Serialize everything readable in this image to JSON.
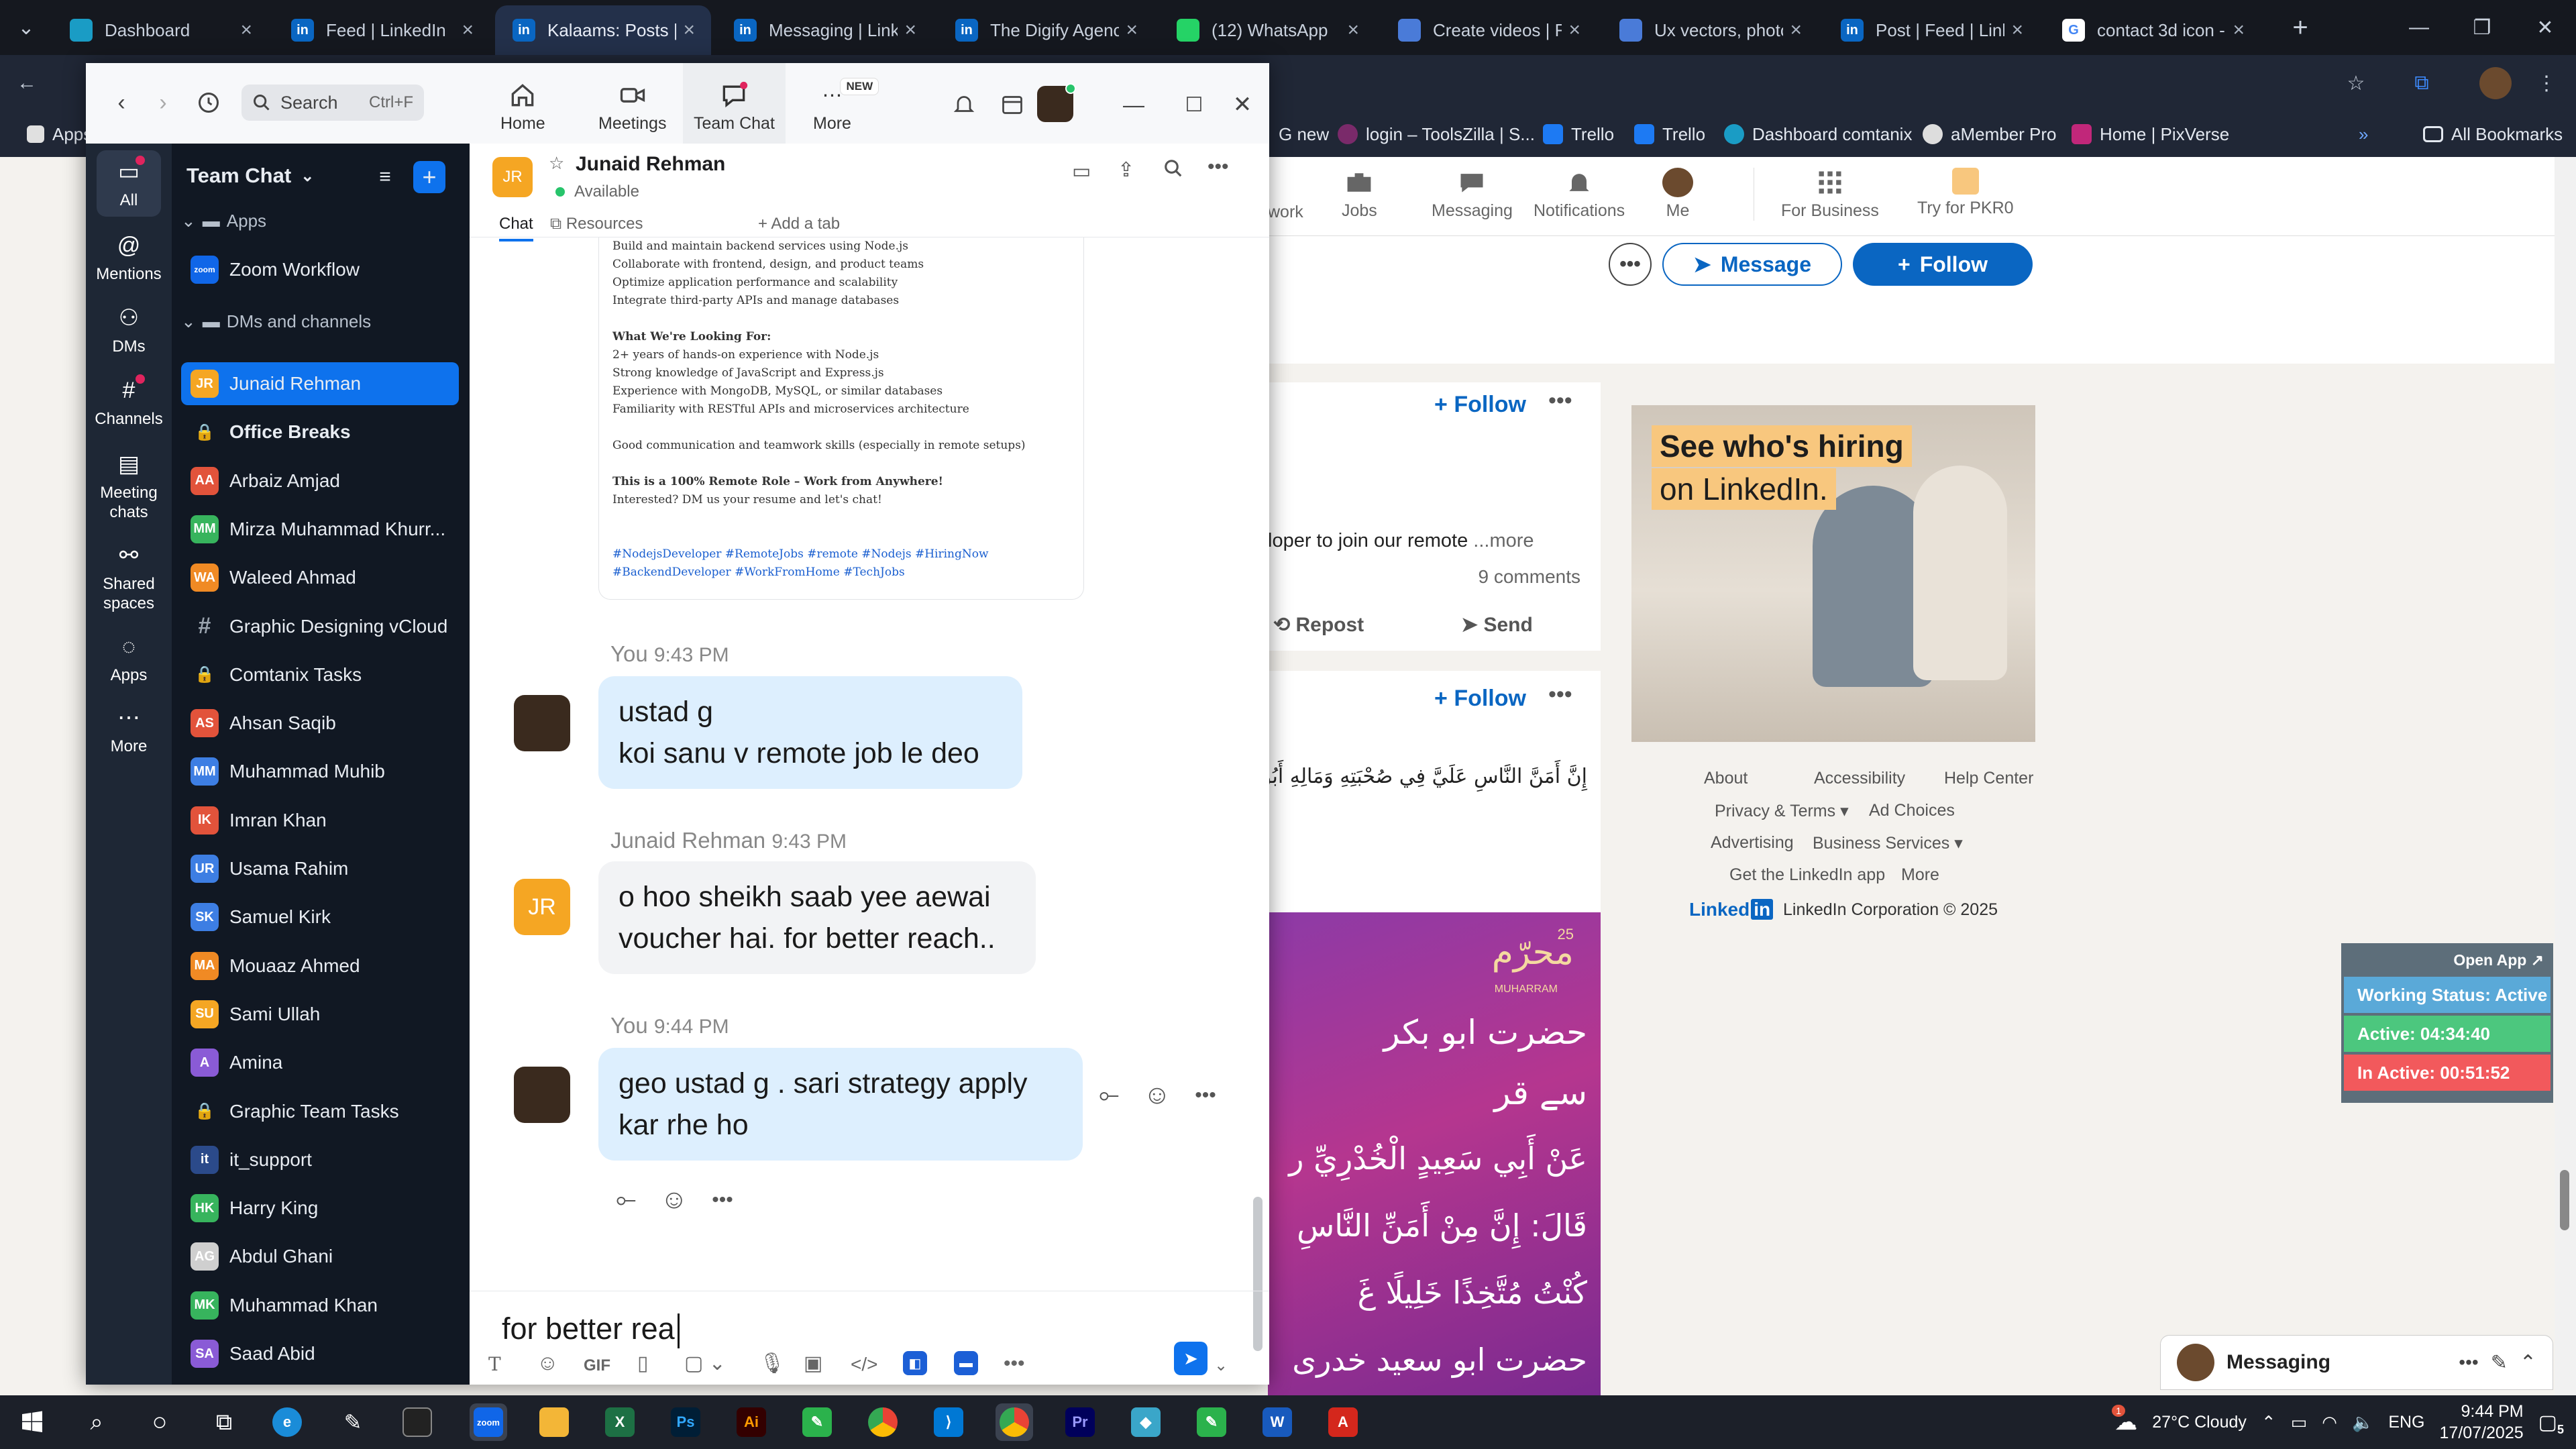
{
  "browser": {
    "tabs": [
      {
        "title": "Dashboard",
        "icon": "dashboard-favicon-icon",
        "color": "#1a9cc5"
      },
      {
        "title": "Feed | LinkedIn",
        "icon": "linkedin-favicon-icon",
        "color": "#0a66c2"
      },
      {
        "title": "Kalaams: Posts | L",
        "icon": "linkedin-favicon-icon",
        "color": "#0a66c2",
        "active": true
      },
      {
        "title": "Messaging | Linke",
        "icon": "linkedin-favicon-icon",
        "color": "#0a66c2"
      },
      {
        "title": "The Digify Agency",
        "icon": "linkedin-favicon-icon",
        "color": "#0a66c2"
      },
      {
        "title": "(12) WhatsApp",
        "icon": "whatsapp-favicon-icon",
        "color": "#25d366"
      },
      {
        "title": "Create videos | Fr",
        "icon": "docs-favicon-icon",
        "color": "#4a7bd8"
      },
      {
        "title": "Ux vectors, photo",
        "icon": "docs-favicon-icon",
        "color": "#4a7bd8"
      },
      {
        "title": "Post | Feed | Linke",
        "icon": "linkedin-favicon-icon",
        "color": "#0a66c2"
      },
      {
        "title": "contact 3d icon -",
        "icon": "google-favicon-icon",
        "color": "#ffffff"
      }
    ],
    "bookmarks": [
      {
        "label": "Apps",
        "color": "#e0e0e0"
      },
      {
        "label": "G new",
        "color": "#4285f4"
      },
      {
        "label": "login – ToolsZilla | S...",
        "color": "#7a2a6a"
      },
      {
        "label": "Trello",
        "color": "#1d7af3"
      },
      {
        "label": "Trello",
        "color": "#1d7af3"
      },
      {
        "label": "Dashboard comtanix",
        "color": "#1a9cc5"
      },
      {
        "label": "aMember Pro",
        "color": "#dddddd"
      },
      {
        "label": "Home | PixVerse",
        "color": "#c1277a"
      }
    ],
    "all_bookmarks": "All Bookmarks"
  },
  "linkedin": {
    "nav": [
      {
        "label": "work",
        "icon": "work-icon"
      },
      {
        "label": "Jobs",
        "icon": "briefcase-icon"
      },
      {
        "label": "Messaging",
        "icon": "messaging-icon"
      },
      {
        "label": "Notifications",
        "icon": "bell-icon"
      },
      {
        "label": "Me",
        "icon": "avatar-icon"
      },
      {
        "label": "For Business",
        "icon": "grid-icon"
      },
      {
        "label": "Try for PKR0",
        "icon": "premium-icon"
      }
    ],
    "message_button": "Message",
    "follow_button": "Follow",
    "card1": {
      "follow": "Follow",
      "snippet": "loper to join our remote",
      "more": "...more",
      "comments": "9 comments",
      "repost": "Repost",
      "send": "Send"
    },
    "card2": {
      "follow": "Follow",
      "arabic": "إِنَّ أَمَنَّ النَّاسِ عَلَيَّ فِي صُحْبَتِهِ وَمَالِهِ أَبُو بَ"
    },
    "post_image_text": [
      "محرّم",
      "MUHARRAM",
      "25",
      "حضرت ابو بکر",
      "سے قر",
      "عَنْ أَبِي سَعِيدٍ الْخُدْرِيِّ ر",
      "قَالَ: إِنَّ مِنْ أَمَنِّ النَّاسِ",
      "كُنْتُ مُتَّخِذًا خَلِيلًا غَ",
      "حضرت ابو سعید خدری"
    ],
    "ad": {
      "line1": "See who's hiring",
      "line2": "on LinkedIn."
    },
    "footer": {
      "links": [
        "About",
        "Accessibility",
        "Help Center",
        "Privacy & Terms",
        "Ad Choices",
        "Advertising",
        "Business Services",
        "Get the LinkedIn app",
        "More"
      ],
      "brand": "Linked",
      "brand_in": "in",
      "copyright": "LinkedIn Corporation © 2025"
    },
    "messaging_label": "Messaging"
  },
  "status_widget": {
    "open_app": "Open App ↗",
    "working": "Working Status: Active",
    "active": "Active: 04:34:40",
    "inactive": "In Active: 00:51:52",
    "colors": {
      "working": "#5aa9d8",
      "active": "#4cc77e",
      "inactive": "#f2595c"
    }
  },
  "zoom": {
    "search": {
      "label": "Search",
      "shortcut": "Ctrl+F"
    },
    "top_tabs": [
      {
        "label": "Home",
        "icon": "home-icon"
      },
      {
        "label": "Meetings",
        "icon": "video-camera-icon"
      },
      {
        "label": "Team Chat",
        "icon": "chat-bubble-icon",
        "active": true
      },
      {
        "label": "More",
        "icon": "more-dots-icon",
        "badge": "NEW"
      }
    ],
    "rail": [
      {
        "label": "All",
        "icon": "chat-bubble-icon",
        "selected": true
      },
      {
        "label": "Mentions",
        "icon": "at-icon"
      },
      {
        "label": "DMs",
        "icon": "people-icon"
      },
      {
        "label": "Channels",
        "icon": "hash-icon"
      },
      {
        "label": "Meeting chats",
        "icon": "calendar-icon"
      },
      {
        "label": "Shared spaces",
        "icon": "shared-icon"
      },
      {
        "label": "Apps",
        "icon": "apps-icon"
      },
      {
        "label": "More",
        "icon": "more-dots-icon"
      }
    ],
    "sidebar": {
      "title": "Team Chat",
      "apps_section": "Apps",
      "zoom_workflow": "Zoom Workflow",
      "dms_section": "DMs and channels",
      "items": [
        {
          "name": "Junaid Rehman",
          "initials": "JR",
          "color": "#f5a623",
          "selected": true
        },
        {
          "name": "Office Breaks",
          "initials": "",
          "color": "#3a4352",
          "lock": true,
          "bold": true
        },
        {
          "name": "Arbaiz Amjad",
          "initials": "AA",
          "color": "#e2533b"
        },
        {
          "name": "Mirza Muhammad Khurr...",
          "initials": "MM",
          "color": "#37b45d"
        },
        {
          "name": "Waleed Ahmad",
          "initials": "WA",
          "color": "#f08a24"
        },
        {
          "name": "Graphic Designing vCloud",
          "initials": "#",
          "color": "#3a4352"
        },
        {
          "name": "Comtanix Tasks",
          "initials": "",
          "color": "#3a4352",
          "lock": true
        },
        {
          "name": "Ahsan Saqib",
          "initials": "AS",
          "color": "#e2533b"
        },
        {
          "name": "Muhammad Muhib",
          "initials": "MM",
          "color": "#3d7ee3"
        },
        {
          "name": "Imran Khan",
          "initials": "IK",
          "color": "#e2533b"
        },
        {
          "name": "Usama Rahim",
          "initials": "UR",
          "color": "#3d7ee3"
        },
        {
          "name": "Samuel Kirk",
          "initials": "SK",
          "color": "#3d7ee3"
        },
        {
          "name": "Mouaaz Ahmed",
          "initials": "MA",
          "color": "#f08a24"
        },
        {
          "name": "Sami Ullah",
          "initials": "SU",
          "color": "#f5a623"
        },
        {
          "name": "Amina",
          "initials": "A",
          "color": "#8a5bd6"
        },
        {
          "name": "Graphic Team Tasks",
          "initials": "",
          "color": "#3a4352",
          "lock": true
        },
        {
          "name": "it_support",
          "initials": "it",
          "color": "#2b4a8a"
        },
        {
          "name": "Harry King",
          "initials": "HK",
          "color": "#37b45d"
        },
        {
          "name": "Abdul Ghani",
          "initials": "AG",
          "color": "#cfcfcf"
        },
        {
          "name": "Muhammad Khan",
          "initials": "MK",
          "color": "#37b45d"
        },
        {
          "name": "Saad Abid",
          "initials": "SA",
          "color": "#8a5bd6"
        }
      ]
    },
    "chat": {
      "contact": {
        "name": "Junaid Rehman",
        "initials": "JR",
        "status": "Available"
      },
      "tabs": {
        "chat": "Chat",
        "resources": "Resources",
        "add": "+ Add a tab"
      },
      "post_lines": [
        "Build and maintain backend services using Node.js",
        "Collaborate with frontend, design, and product teams",
        "Optimize application performance and scalability",
        "Integrate third-party APIs and manage databases",
        "",
        "What We're Looking For:",
        "2+ years of hands-on experience with Node.js",
        "Strong knowledge of JavaScript and Express.js",
        "Experience with MongoDB, MySQL, or similar databases",
        "Familiarity with RESTful APIs and microservices architecture",
        "",
        "Good communication and teamwork skills (especially in remote setups)",
        "",
        "This is a 100% Remote Role – Work from Anywhere!",
        "Interested? DM us your resume and let's chat!",
        "",
        "",
        "#NodejsDeveloper #RemoteJobs #remote #Nodejs #HiringNow",
        "#BackendDeveloper #WorkFromHome #TechJobs"
      ],
      "messages": [
        {
          "sender": "You",
          "time": "9:43 PM",
          "lines": [
            "ustad g",
            "koi sanu v remote job le deo"
          ],
          "mine": true
        },
        {
          "sender": "Junaid Rehman",
          "time": "9:43 PM",
          "lines": [
            "o hoo sheikh saab yee aewai",
            "voucher hai. for better reach.."
          ],
          "mine": false
        },
        {
          "sender": "You",
          "time": "9:44 PM",
          "lines": [
            "geo ustad g . sari strategy apply",
            "kar rhe ho"
          ],
          "mine": true
        }
      ],
      "composer_text": "for better rea"
    }
  },
  "taskbar": {
    "weather": "27°C  Cloudy",
    "weather_badge": "1",
    "lang": "ENG",
    "time": "9:44 PM",
    "date": "17/07/2025",
    "notifications": "5"
  }
}
